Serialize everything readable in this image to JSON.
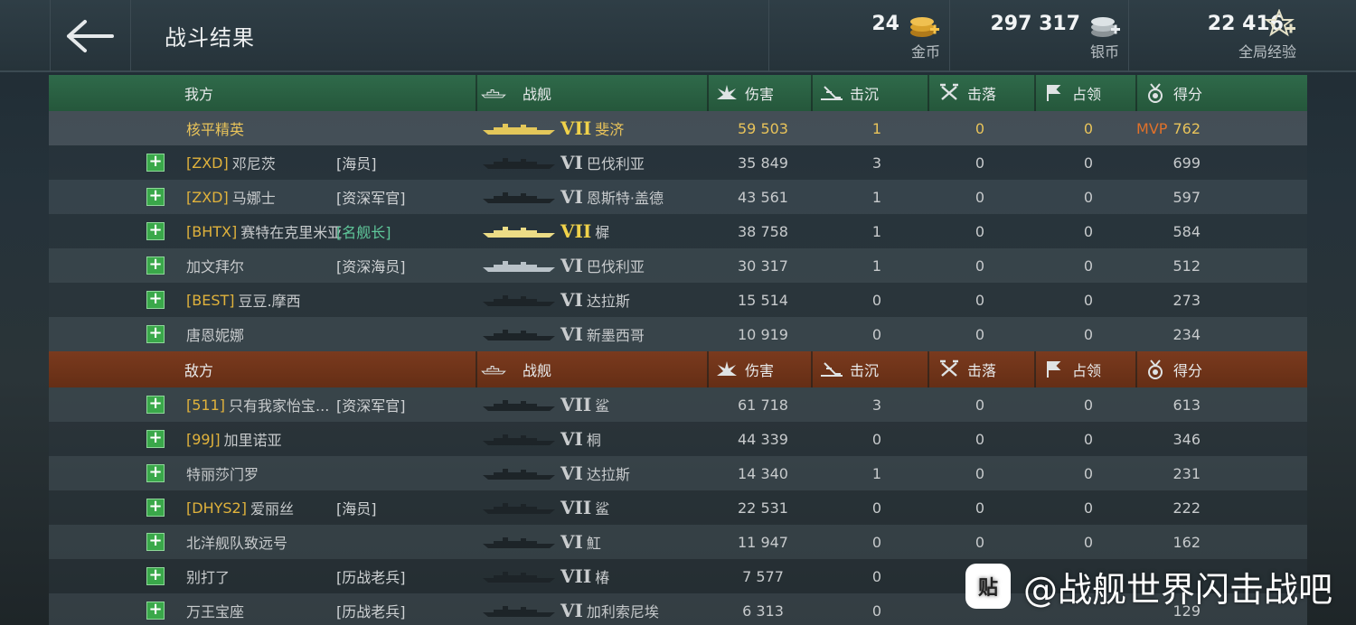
{
  "page": {
    "title": "战斗结果"
  },
  "currency": [
    {
      "value": "24",
      "label": "金币",
      "icon": "gold-coins-icon"
    },
    {
      "value": "297 317",
      "label": "银币",
      "icon": "silver-coins-icon"
    },
    {
      "value": "22 416",
      "label": "全局经验",
      "icon": "xp-star-icon"
    }
  ],
  "columns": {
    "ship": "战舰",
    "damage": "伤害",
    "sunk": "击沉",
    "downed": "击落",
    "capture": "占领",
    "score": "得分"
  },
  "ally": {
    "label": "我方",
    "rows": [
      {
        "clan": "",
        "name": "核平精英",
        "rank": "",
        "tier": "VII",
        "ship": "斐济",
        "damage": "59 503",
        "sunk": "1",
        "downed": "0",
        "capture": "0",
        "mvp": "MVP",
        "score": "762",
        "me": true
      },
      {
        "clan": "[ZXD]",
        "name": "邓尼茨",
        "rank": "[海员]",
        "tier": "VI",
        "ship": "巴伐利亚",
        "damage": "35 849",
        "sunk": "3",
        "downed": "0",
        "capture": "0",
        "score": "699"
      },
      {
        "clan": "[ZXD]",
        "name": "马娜士",
        "rank": "[资深军官]",
        "tier": "VI",
        "ship": "恩斯特·盖德",
        "damage": "43 561",
        "sunk": "1",
        "downed": "0",
        "capture": "0",
        "score": "597"
      },
      {
        "clan": "[BHTX]",
        "name": "赛特在克里米亚",
        "rank": "[名舰长]",
        "tier": "VII",
        "ship": "樨",
        "damage": "38 758",
        "sunk": "1",
        "downed": "0",
        "capture": "0",
        "score": "584",
        "green": true,
        "gold": true
      },
      {
        "clan": "",
        "name": "加文拜尔",
        "rank": "[资深海员]",
        "tier": "VI",
        "ship": "巴伐利亚",
        "damage": "30 317",
        "sunk": "1",
        "downed": "0",
        "capture": "0",
        "score": "512",
        "white": true
      },
      {
        "clan": "[BEST]",
        "name": "豆豆.摩西",
        "rank": "",
        "tier": "VI",
        "ship": "达拉斯",
        "damage": "15 514",
        "sunk": "0",
        "downed": "0",
        "capture": "0",
        "score": "273"
      },
      {
        "clan": "",
        "name": "唐恩妮娜",
        "rank": "",
        "tier": "VI",
        "ship": "新墨西哥",
        "damage": "10 919",
        "sunk": "0",
        "downed": "0",
        "capture": "0",
        "score": "234"
      }
    ]
  },
  "enemy": {
    "label": "敌方",
    "rows": [
      {
        "clan": "[511]",
        "name": "只有我家怡宝...",
        "rank": "[资深军官]",
        "tier": "VII",
        "ship": "鲨",
        "damage": "61 718",
        "sunk": "3",
        "downed": "0",
        "capture": "0",
        "score": "613"
      },
      {
        "clan": "[99J]",
        "name": "加里诺亚",
        "rank": "",
        "tier": "VI",
        "ship": "桐",
        "damage": "44 339",
        "sunk": "0",
        "downed": "0",
        "capture": "0",
        "score": "346"
      },
      {
        "clan": "",
        "name": "特丽莎门罗",
        "rank": "",
        "tier": "VI",
        "ship": "达拉斯",
        "damage": "14 340",
        "sunk": "1",
        "downed": "0",
        "capture": "0",
        "score": "231"
      },
      {
        "clan": "[DHYS2]",
        "name": "爱丽丝",
        "rank": "[海员]",
        "tier": "VII",
        "ship": "鲨",
        "damage": "22 531",
        "sunk": "0",
        "downed": "0",
        "capture": "0",
        "score": "222"
      },
      {
        "clan": "",
        "name": "北洋舰队致远号",
        "rank": "",
        "tier": "VI",
        "ship": "魟",
        "damage": "11 947",
        "sunk": "0",
        "downed": "0",
        "capture": "0",
        "score": "162"
      },
      {
        "clan": "",
        "name": "别打了",
        "rank": "[历战老兵]",
        "tier": "VII",
        "ship": "椿",
        "damage": "7 577",
        "sunk": "0",
        "downed": "",
        "capture": "",
        "score": ""
      },
      {
        "clan": "",
        "name": "万王宝座",
        "rank": "[历战老兵]",
        "tier": "VI",
        "ship": "加利索尼埃",
        "damage": "6 313",
        "sunk": "0",
        "downed": "",
        "capture": "",
        "score": "129"
      }
    ]
  },
  "watermark": {
    "logo": "贴",
    "text": "@战舰世界闪击战吧"
  }
}
